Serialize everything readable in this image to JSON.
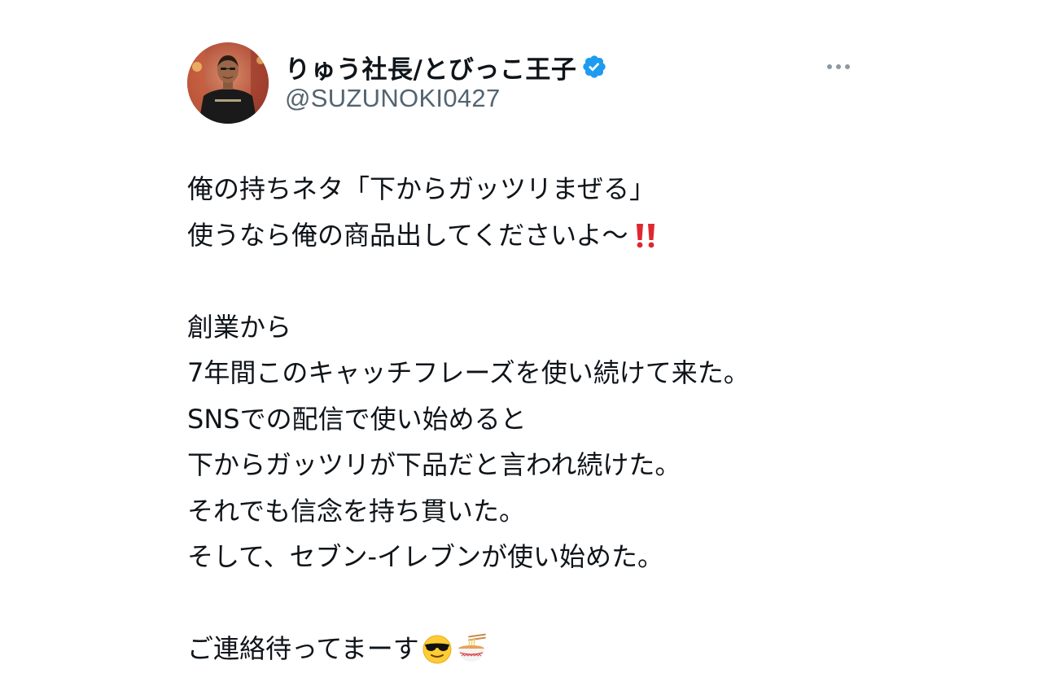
{
  "author": {
    "display_name": "りゅう社長/とびっこ王子",
    "handle": "@SUZUNOKI0427",
    "verified": true,
    "avatar_icon": "profile-photo"
  },
  "menu": {
    "more_icon": "more-horizontal-icon"
  },
  "colors": {
    "text": "#0f1419",
    "secondary": "#536471",
    "verified_blue": "#1d9bf0",
    "exclamation_red": "#e0262f"
  },
  "tweet": {
    "lines": [
      "俺の持ちネタ「下からガッツリまぜる」",
      "使うなら俺の商品出してくださいよ〜",
      "",
      "創業から",
      "7年間このキャッチフレーズを使い続けて来た。",
      "SNSでの配信で使い始めると",
      "下からガッツリが下品だと言われ続けた。",
      "それでも信念を持ち貫いた。",
      "そして、セブン-イレブンが使い始めた。",
      "",
      "ご連絡待ってまーす"
    ],
    "emojis": {
      "line2": "double-exclamation-emoji",
      "line11": [
        "sunglasses-face-emoji",
        "ramen-bowl-emoji"
      ]
    }
  }
}
